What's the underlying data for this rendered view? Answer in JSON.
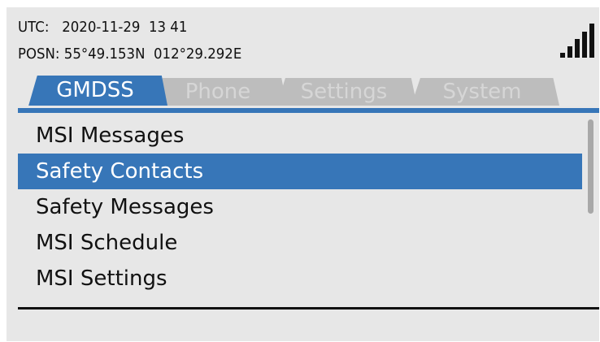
{
  "status": {
    "utc_label": "UTC:",
    "utc_value": "2020-11-29  13 41",
    "posn_label": "POSN:",
    "posn_value": "55°49.153N  012°29.292E",
    "signal_icon": "signal-strength-icon"
  },
  "tabs": [
    {
      "label": "GMDSS",
      "active": true
    },
    {
      "label": "Phone",
      "active": false
    },
    {
      "label": "Settings",
      "active": false
    },
    {
      "label": "System",
      "active": false
    }
  ],
  "menu": {
    "items": [
      {
        "label": "MSI Messages",
        "selected": false
      },
      {
        "label": "Safety Contacts",
        "selected": true
      },
      {
        "label": "Safety Messages",
        "selected": false
      },
      {
        "label": "MSI Schedule",
        "selected": false
      },
      {
        "label": "MSI Settings",
        "selected": false
      }
    ]
  },
  "colors": {
    "accent": "#3776b8",
    "background": "#e7e7e7",
    "inactive_tab": "#bdbdbd",
    "text": "#111111"
  }
}
